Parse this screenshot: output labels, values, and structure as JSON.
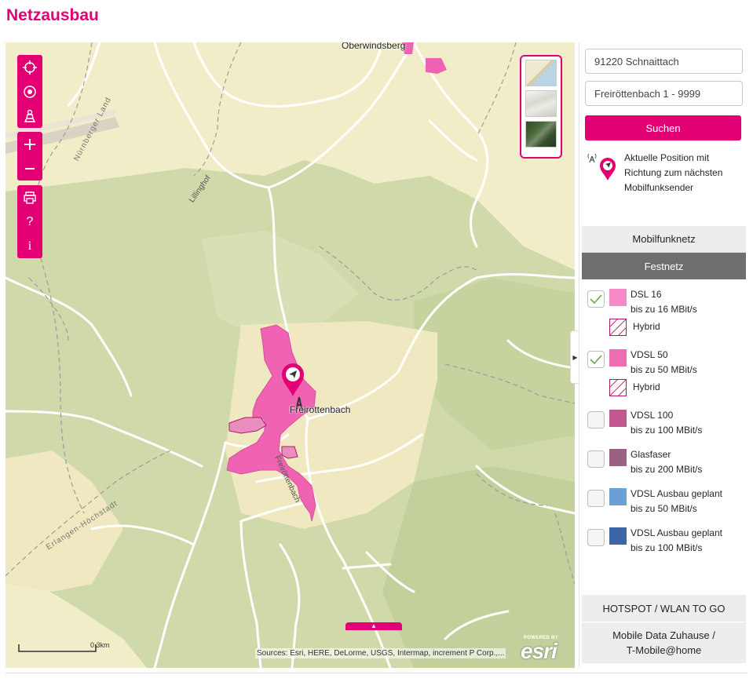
{
  "page": {
    "title": "Netzausbau"
  },
  "map": {
    "place_labels": {
      "oberwindsberg": "Oberwindsberg",
      "freirottenbach": "Freiröttenbach",
      "freirottenbach_street": "Freiröttenbach",
      "lillinghof": "Lillinghof",
      "nurnberger_land": "Nürnberger Land",
      "erlangen_hochstadt": "Erlangen-Höchstadt"
    },
    "scale_label": "0.3km",
    "attribution": "Sources: Esri, HERE, DeLorme, USGS, Intermap, increment P Corp.,...",
    "esri": {
      "powered_by": "POWERED BY",
      "logo": "esri"
    },
    "toolbar": [
      {
        "name": "locate-icon",
        "glyph": "crosshair"
      },
      {
        "name": "position-icon",
        "glyph": "target"
      },
      {
        "name": "person-icon",
        "glyph": "person"
      },
      {
        "name": "zoom-in-icon",
        "glyph": "+"
      },
      {
        "name": "zoom-out-icon",
        "glyph": "−"
      },
      {
        "name": "print-icon",
        "glyph": "printer"
      },
      {
        "name": "help-icon",
        "glyph": "?"
      },
      {
        "name": "info-icon",
        "glyph": "i"
      }
    ]
  },
  "search": {
    "location_value": "91220 Schnaittach",
    "street_value": "Freiröttenbach 1 - 9999",
    "button_label": "Suchen"
  },
  "position_info": {
    "line1": "Aktuelle Position mit",
    "line2": "Richtung zum nächsten",
    "line3": "Mobilfunksender"
  },
  "tabs": {
    "mobilfunknetz": "Mobilfunknetz",
    "festnetz": "Festnetz"
  },
  "legend": {
    "items": [
      {
        "title": "DSL 16",
        "subtitle": "bis zu 16 MBit/s",
        "checked": true,
        "color": "#f78ac6"
      },
      {
        "title": "VDSL 50",
        "subtitle": "bis zu 50 MBit/s",
        "checked": true,
        "color": "#ee6db2"
      },
      {
        "title": "VDSL 100",
        "subtitle": "bis zu 100 MBit/s",
        "checked": false,
        "color": "#c2568e"
      },
      {
        "title": "Glasfaser",
        "subtitle": "bis zu 200 MBit/s",
        "checked": false,
        "color": "#9a6282"
      },
      {
        "title": "VDSL Ausbau geplant",
        "subtitle": "bis zu 50 MBit/s",
        "checked": false,
        "color": "#6aa0d6"
      },
      {
        "title": "VDSL Ausbau geplant",
        "subtitle": "bis zu 100 MBit/s",
        "checked": false,
        "color": "#3b67a8"
      }
    ],
    "hybrid_label_1": "Hybrid",
    "hybrid_label_2": "Hybrid"
  },
  "bottom_tabs": {
    "hotspot": "HOTSPOT / WLAN TO GO",
    "mobile_data_line1": "Mobile Data Zuhause /",
    "mobile_data_line2": "T-Mobile@home"
  },
  "colors": {
    "brand": "#e20074",
    "coverage": "#ef5fb0",
    "forest": "#c9d6a4",
    "land": "#f2edc9"
  }
}
